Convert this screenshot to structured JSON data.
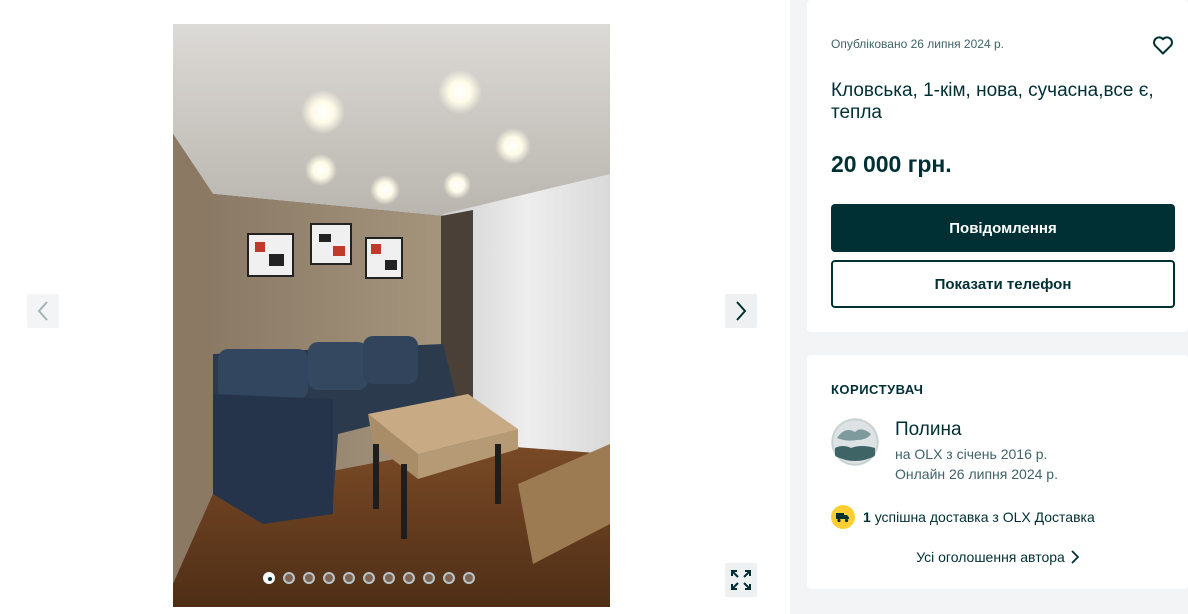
{
  "gallery": {
    "photo_alt": "apartment-living-room-photo",
    "dots_total": 11,
    "active_dot": 1
  },
  "ad": {
    "published": "Опубліковано 26 липня 2024 р.",
    "title": "Кловська, 1-кім, нова, сучасна,все є, тепла",
    "price": "20 000 грн.",
    "message_button": "Повідомлення",
    "phone_button": "Показати телефон"
  },
  "user": {
    "heading": "КОРИСТУВАЧ",
    "name": "Полина",
    "since": "на OLX з січень 2016 р.",
    "online": "Онлайн 26 липня 2024 р.",
    "delivery_count": "1",
    "delivery_text": "успішна доставка з OLX Доставка",
    "all_ads_link": "Усі оголошення автора"
  },
  "icons": {
    "prev": "chevron-left-icon",
    "next": "chevron-right-icon",
    "expand": "expand-icon",
    "favorite": "heart-icon",
    "delivery": "truck-icon"
  },
  "colors": {
    "primary": "#002f34",
    "accent_yellow": "#ffce32",
    "background": "#f2f4f5"
  }
}
